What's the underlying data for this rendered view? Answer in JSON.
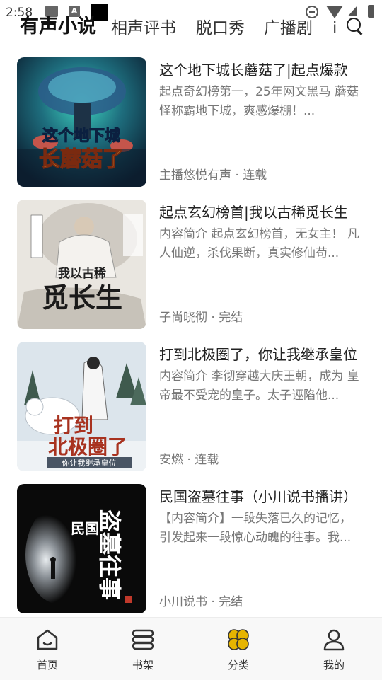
{
  "status_bar": {
    "time": "2:58",
    "notif_a": "A"
  },
  "tabs": [
    {
      "label": "有声小说",
      "active": true
    },
    {
      "label": "相声评书"
    },
    {
      "label": "脱口秀"
    },
    {
      "label": "广播剧"
    },
    {
      "label": "i"
    }
  ],
  "books": [
    {
      "title": "这个地下城长蘑菇了|起点爆款",
      "desc": "起点奇幻榜第一，25年网文黑马 蘑菇怪称霸地下城，爽感爆棚！...",
      "meta": "主播悠悦有声 · 连载",
      "cover_text_1": "这个地下城",
      "cover_text_2": "长蘑菇了",
      "cover_colors": [
        "#0d2a40",
        "#1e8c7e",
        "#e8d24a"
      ]
    },
    {
      "title": "起点玄幻榜首|我以古稀觅长生",
      "desc": "内容简介 起点玄幻榜首，无女主！ 凡人仙逆，杀伐果断，真实修仙苟...",
      "meta": "子尚晓彻 · 完结",
      "cover_text_1": "我以古稀",
      "cover_text_2": "觅长生",
      "cover_colors": [
        "#e8e6e1",
        "#7a7a78",
        "#b3261e"
      ]
    },
    {
      "title": "打到北极圈了，你让我继承皇位",
      "desc": "内容简介 李彻穿越大庆王朝，成为 皇帝最不受宠的皇子。太子诬陷他...",
      "meta": "安燃 · 连载",
      "cover_text_1": "打到",
      "cover_text_2": "北极圈了",
      "cover_text_3": "你让我继承皇位",
      "cover_colors": [
        "#dfe7ee",
        "#ffffff",
        "#a8321f"
      ]
    },
    {
      "title": "民国盗墓往事（小川说书播讲）",
      "desc": "【内容简介】一段失落已久的记忆， 引发起来一段惊心动魄的往事。我...",
      "meta": "小川说书 · 完结",
      "cover_text_1": "民国",
      "cover_text_2": "盗墓往事",
      "cover_colors": [
        "#0a0a0a",
        "#9aa0a6",
        "#ffffff"
      ]
    }
  ],
  "bottom_nav": [
    {
      "label": "首页",
      "icon": "home-icon"
    },
    {
      "label": "书架",
      "icon": "bookshelf-icon"
    },
    {
      "label": "分类",
      "icon": "category-icon",
      "active": true,
      "color": "#e6b400"
    },
    {
      "label": "我的",
      "icon": "profile-icon"
    }
  ]
}
